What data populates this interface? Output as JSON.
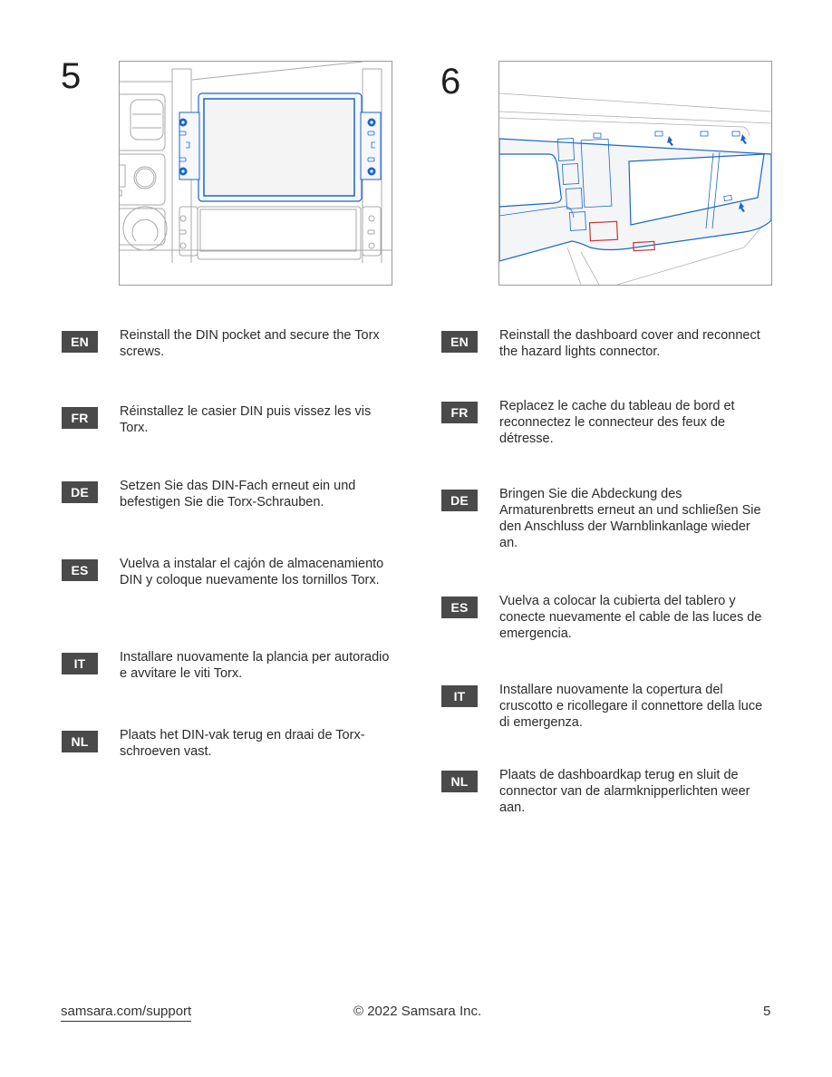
{
  "steps": [
    {
      "number": "5",
      "figure_alt": "DIN pocket installed in dashboard with Torx screws highlighted",
      "instructions": [
        {
          "lang": "EN",
          "text": "Reinstall the DIN pocket and secure the Torx screws."
        },
        {
          "lang": "FR",
          "text": "Réinstallez le casier DIN puis vissez les vis Torx."
        },
        {
          "lang": "DE",
          "text": "Setzen Sie das DIN-Fach erneut ein und befestigen Sie die Torx-Schrauben."
        },
        {
          "lang": "ES",
          "text": "Vuelva a instalar el cajón de almacenamiento DIN y coloque nuevamente los tornillos Torx."
        },
        {
          "lang": "IT",
          "text": "Installare nuovamente la plancia per autoradio e avvitare le viti Torx."
        },
        {
          "lang": "NL",
          "text": "Plaats het DIN-vak terug en draai de Torx-schroeven vast."
        }
      ]
    },
    {
      "number": "6",
      "figure_alt": "Dashboard cover reinstalled with clip arrows and hazard connector highlighted",
      "instructions": [
        {
          "lang": "EN",
          "text": "Reinstall the dashboard cover and reconnect the hazard lights connector."
        },
        {
          "lang": "FR",
          "text": "Replacez le cache du tableau de bord et reconnectez le connecteur des feux de détresse."
        },
        {
          "lang": "DE",
          "text": "Bringen Sie die Abdeckung des Armaturenbretts erneut an und schließen Sie den Anschluss der Warnblinkanlage wieder an."
        },
        {
          "lang": "ES",
          "text": "Vuelva a colocar la cubierta del tablero y conecte nuevamente el cable de las luces de emergencia."
        },
        {
          "lang": "IT",
          "text": "Installare nuovamente la copertura del cruscotto e ricollegare il connettore della luce di emergenza."
        },
        {
          "lang": "NL",
          "text": "Plaats de dashboardkap terug en sluit de connector van de alarmknipperlichten weer aan."
        }
      ]
    }
  ],
  "footer": {
    "link": "samsara.com/support",
    "copyright": "© 2022 Samsara Inc.",
    "page_number": "5"
  },
  "colors": {
    "highlight_blue": "#1a66cc",
    "highlight_red": "#d23030",
    "badge_bg": "#4a4a4a"
  }
}
